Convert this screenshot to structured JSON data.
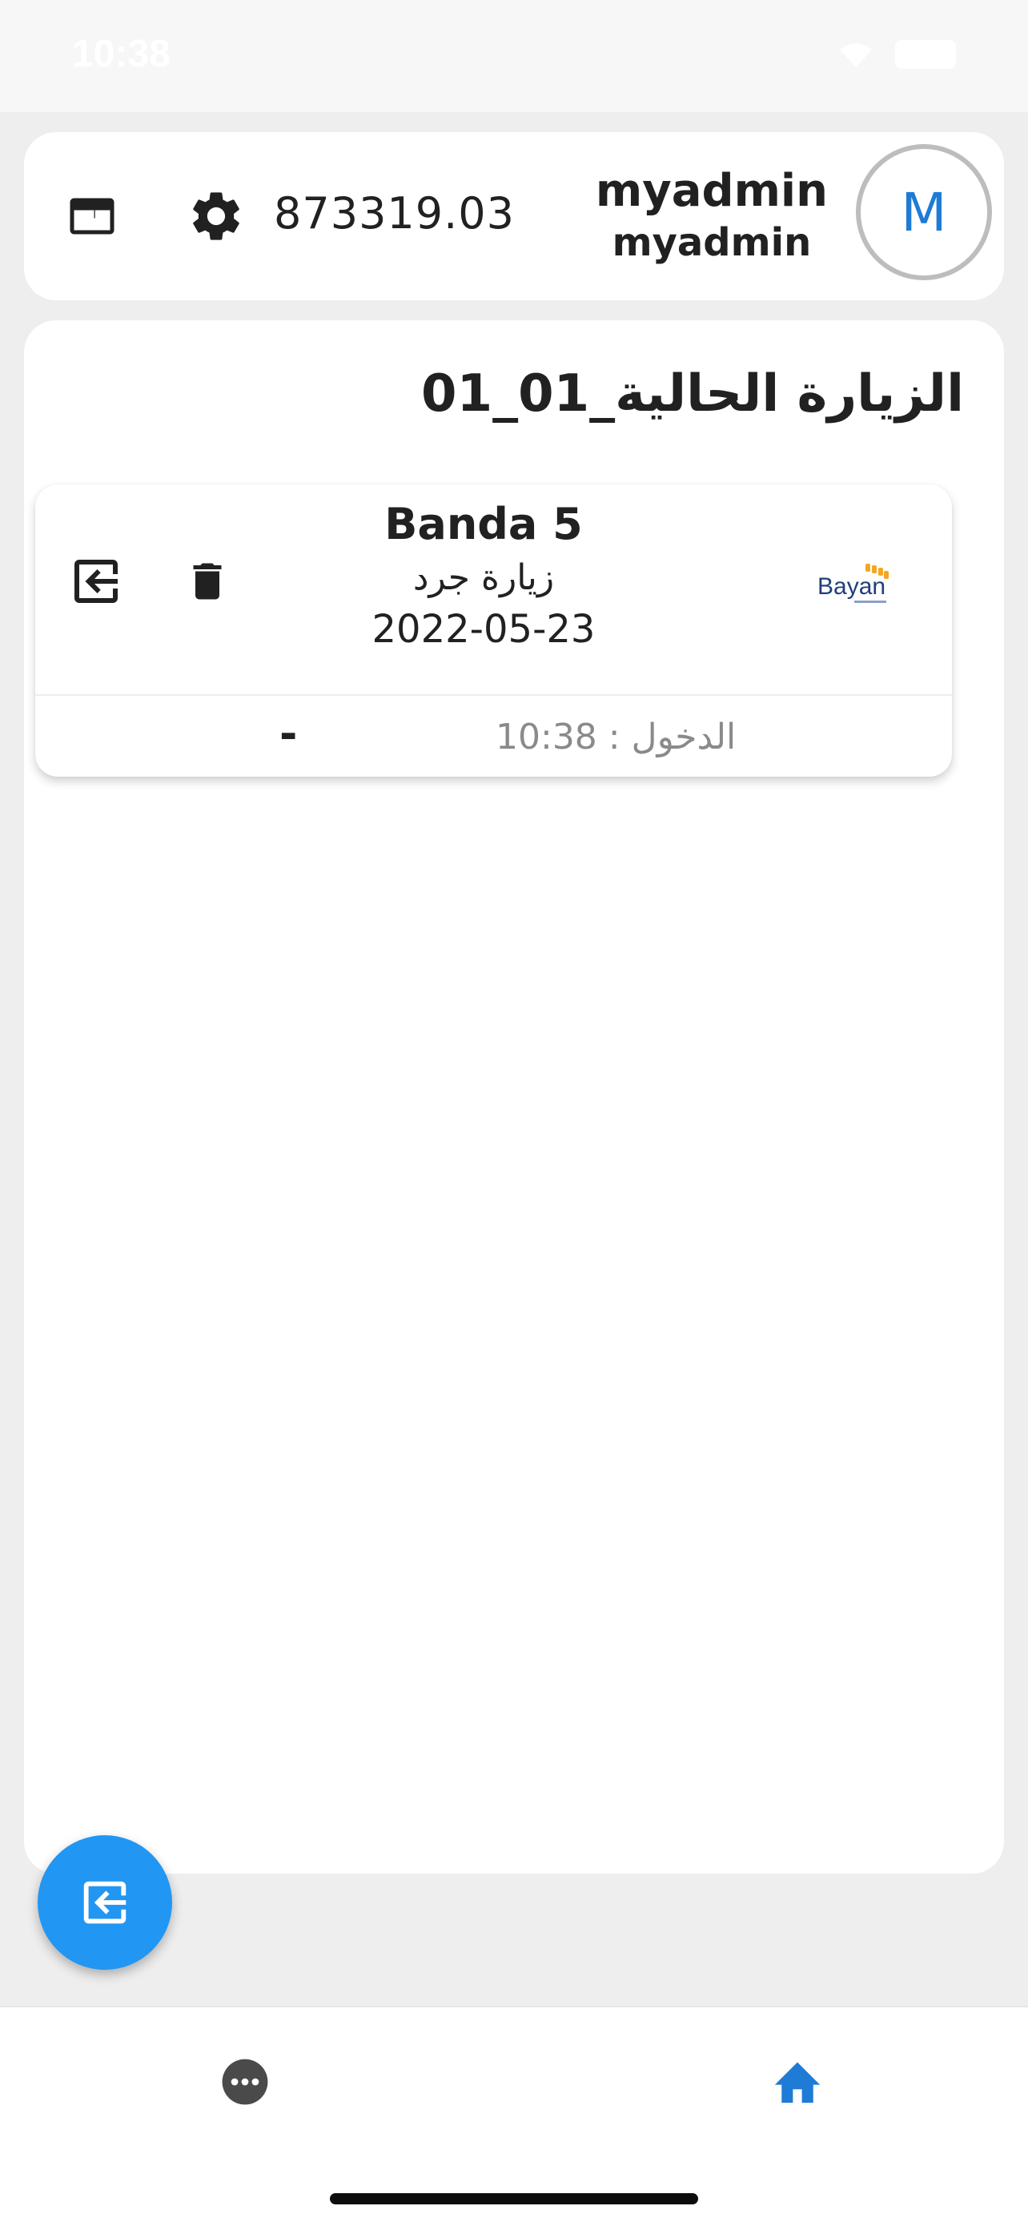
{
  "status_bar": {
    "time": "10:38"
  },
  "header": {
    "balance": "873319.03",
    "user_name": "myadmin",
    "user_sub": "myadmin",
    "avatar_initial": "M"
  },
  "page": {
    "title": "الزيارة الحالية_01_01"
  },
  "visit": {
    "client": "Banda 5",
    "type": "زيارة جرد",
    "date": "2022-05-23",
    "logo_text": "Bayan",
    "checkin": "الدخول : 10:38",
    "checkout": "-"
  },
  "colors": {
    "accent": "#2196f3",
    "home_active": "#1e7bd6",
    "icon_dark": "#212121",
    "logo_gold": "#f5a623",
    "logo_navy": "#1f3f7a"
  },
  "icons": {
    "header": [
      "layout-icon",
      "gear-icon"
    ],
    "visit": [
      "exit-icon",
      "trash-icon"
    ],
    "fab": "exit-icon",
    "nav": [
      "more-icon",
      "home-icon"
    ]
  }
}
